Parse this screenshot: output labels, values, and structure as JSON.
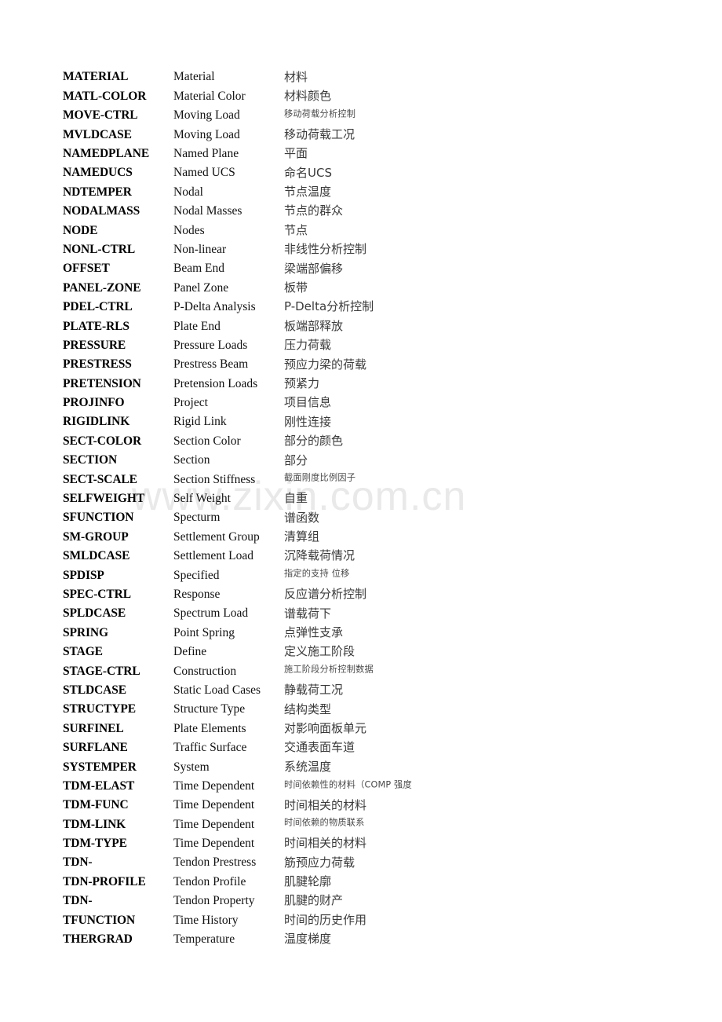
{
  "document": {
    "type": "glossary-table",
    "description": "Three-column bilingual glossary of MIDAS structural analysis data keywords",
    "columns": [
      "code",
      "english",
      "chinese"
    ]
  },
  "watermark": {
    "text": "www.zixin.com.cn",
    "color": "#e9e9ea"
  },
  "rows": [
    {
      "code": "MATERIAL",
      "english": "Material",
      "chinese": "材料",
      "wrapped": false
    },
    {
      "code": "MATL-COLOR",
      "english": "Material Color",
      "chinese": "材料颜色",
      "wrapped": false
    },
    {
      "code": "MOVE-CTRL",
      "english": "Moving Load",
      "chinese": "移动荷载分析控制",
      "wrapped": true
    },
    {
      "code": "MVLDCASE",
      "english": "Moving Load",
      "chinese": "移动荷载工况",
      "wrapped": false
    },
    {
      "code": "NAMEDPLANE",
      "english": "Named Plane",
      "chinese": "平面",
      "wrapped": false
    },
    {
      "code": "NAMEDUCS",
      "english": "Named UCS",
      "chinese": "命名UCS",
      "wrapped": false
    },
    {
      "code": "NDTEMPER",
      "english": "Nodal",
      "chinese": "节点温度",
      "wrapped": false
    },
    {
      "code": "NODALMASS",
      "english": "Nodal Masses",
      "chinese": "节点的群众",
      "wrapped": false
    },
    {
      "code": "NODE",
      "english": "Nodes",
      "chinese": "节点",
      "wrapped": false
    },
    {
      "code": "NONL-CTRL",
      "english": "Non-linear",
      "chinese": "非线性分析控制",
      "wrapped": false
    },
    {
      "code": "OFFSET",
      "english": "Beam End",
      "chinese": "梁端部偏移",
      "wrapped": false
    },
    {
      "code": "PANEL-ZONE",
      "english": "Panel Zone",
      "chinese": "板带",
      "wrapped": false
    },
    {
      "code": "PDEL-CTRL",
      "english": "P-Delta Analysis",
      "chinese": "P-Delta分析控制",
      "wrapped": false
    },
    {
      "code": "PLATE-RLS",
      "english": "Plate End",
      "chinese": "板端部释放",
      "wrapped": false
    },
    {
      "code": "PRESSURE",
      "english": "Pressure Loads",
      "chinese": "压力荷载",
      "wrapped": false
    },
    {
      "code": "PRESTRESS",
      "english": "Prestress Beam",
      "chinese": "预应力梁的荷载",
      "wrapped": false
    },
    {
      "code": "PRETENSION",
      "english": "Pretension Loads",
      "chinese": "预紧力",
      "wrapped": false
    },
    {
      "code": "PROJINFO",
      "english": "Project",
      "chinese": "项目信息",
      "wrapped": false
    },
    {
      "code": "RIGIDLINK",
      "english": "Rigid Link",
      "chinese": "刚性连接",
      "wrapped": false
    },
    {
      "code": "SECT-COLOR",
      "english": "Section Color",
      "chinese": "部分的颜色",
      "wrapped": false
    },
    {
      "code": "SECTION",
      "english": "Section",
      "chinese": "部分",
      "wrapped": false
    },
    {
      "code": "SECT-SCALE",
      "english": "Section Stiffness",
      "chinese": "截面刚度比例因子",
      "wrapped": true
    },
    {
      "code": "SELFWEIGHT",
      "english": "Self Weight",
      "chinese": "自重",
      "wrapped": false
    },
    {
      "code": "SFUNCTION",
      "english": "Specturm",
      "chinese": "谱函数",
      "wrapped": false
    },
    {
      "code": "SM-GROUP",
      "english": "Settlement Group",
      "chinese": "清算组",
      "wrapped": false
    },
    {
      "code": "SMLDCASE",
      "english": "Settlement Load",
      "chinese": "沉降载荷情况",
      "wrapped": false
    },
    {
      "code": "SPDISP",
      "english": "Specified",
      "chinese": "指定的支持 位移",
      "wrapped": true
    },
    {
      "code": "SPEC-CTRL",
      "english": "Response",
      "chinese": "反应谱分析控制",
      "wrapped": false
    },
    {
      "code": "SPLDCASE",
      "english": "Spectrum Load",
      "chinese": "谱载荷下",
      "wrapped": false
    },
    {
      "code": "SPRING",
      "english": "Point Spring",
      "chinese": "点弹性支承",
      "wrapped": false
    },
    {
      "code": "STAGE",
      "english": "Define",
      "chinese": "定义施工阶段",
      "wrapped": false
    },
    {
      "code": "STAGE-CTRL",
      "english": "Construction",
      "chinese": "施工阶段分析控制数据",
      "wrapped": true
    },
    {
      "code": "STLDCASE",
      "english": "Static Load Cases",
      "chinese": "静载荷工况",
      "wrapped": false
    },
    {
      "code": "STRUCTYPE",
      "english": "Structure Type",
      "chinese": "结构类型",
      "wrapped": false
    },
    {
      "code": "SURFINEL",
      "english": "Plate Elements",
      "chinese": "对影响面板单元",
      "wrapped": false
    },
    {
      "code": "SURFLANE",
      "english": "Traffic Surface",
      "chinese": "交通表面车道",
      "wrapped": false
    },
    {
      "code": "SYSTEMPER",
      "english": "System",
      "chinese": "系统温度",
      "wrapped": false
    },
    {
      "code": "TDM-ELAST",
      "english": "Time Dependent",
      "chinese": "时间依赖性的材料（COMP 强度",
      "wrapped": true
    },
    {
      "code": "TDM-FUNC",
      "english": "Time Dependent",
      "chinese": "时间相关的材料",
      "wrapped": false
    },
    {
      "code": "TDM-LINK",
      "english": "Time Dependent",
      "chinese": "时间依赖的物质联系",
      "wrapped": true
    },
    {
      "code": "TDM-TYPE",
      "english": "Time Dependent",
      "chinese": "时间相关的材料",
      "wrapped": false
    },
    {
      "code": "TDN-",
      "english": "Tendon Prestress",
      "chinese": "筋预应力荷载",
      "wrapped": false
    },
    {
      "code": "TDN-PROFILE",
      "english": "Tendon Profile",
      "chinese": "肌腱轮廓",
      "wrapped": false
    },
    {
      "code": "TDN-",
      "english": "Tendon Property",
      "chinese": "肌腱的财产",
      "wrapped": false
    },
    {
      "code": "TFUNCTION",
      "english": "Time History",
      "chinese": "时间的历史作用",
      "wrapped": false
    },
    {
      "code": "THERGRAD",
      "english": "Temperature",
      "chinese": "温度梯度",
      "wrapped": false
    }
  ]
}
